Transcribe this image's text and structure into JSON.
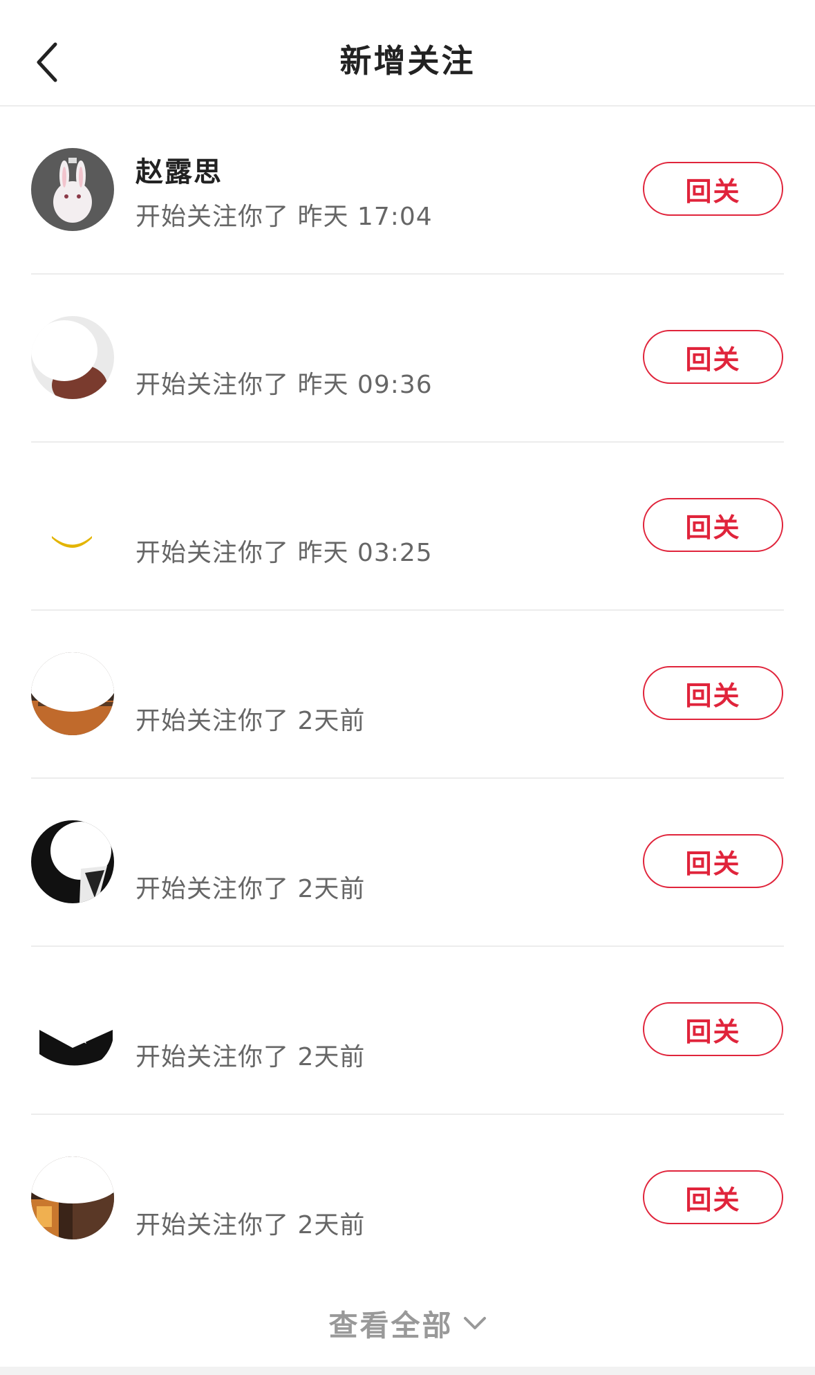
{
  "header": {
    "title": "新增关注",
    "back_icon": "chevron-left-icon"
  },
  "accent_color": "#e0243b",
  "followers": [
    {
      "name": "赵露思",
      "action": "开始关注你了",
      "time": "昨天 17:04",
      "button": "回关"
    },
    {
      "name": "",
      "action": "开始关注你了",
      "time": "昨天 09:36",
      "button": "回关"
    },
    {
      "name": "",
      "action": "开始关注你了",
      "time": "昨天 03:25",
      "button": "回关"
    },
    {
      "name": "",
      "action": "开始关注你了",
      "time": "2天前",
      "button": "回关"
    },
    {
      "name": "",
      "action": "开始关注你了",
      "time": "2天前",
      "button": "回关"
    },
    {
      "name": "",
      "action": "开始关注你了",
      "time": "2天前",
      "button": "回关"
    },
    {
      "name": "",
      "action": "开始关注你了",
      "time": "2天前",
      "button": "回关"
    }
  ],
  "footer": {
    "view_all": "查看全部",
    "icon": "chevron-down-icon"
  }
}
